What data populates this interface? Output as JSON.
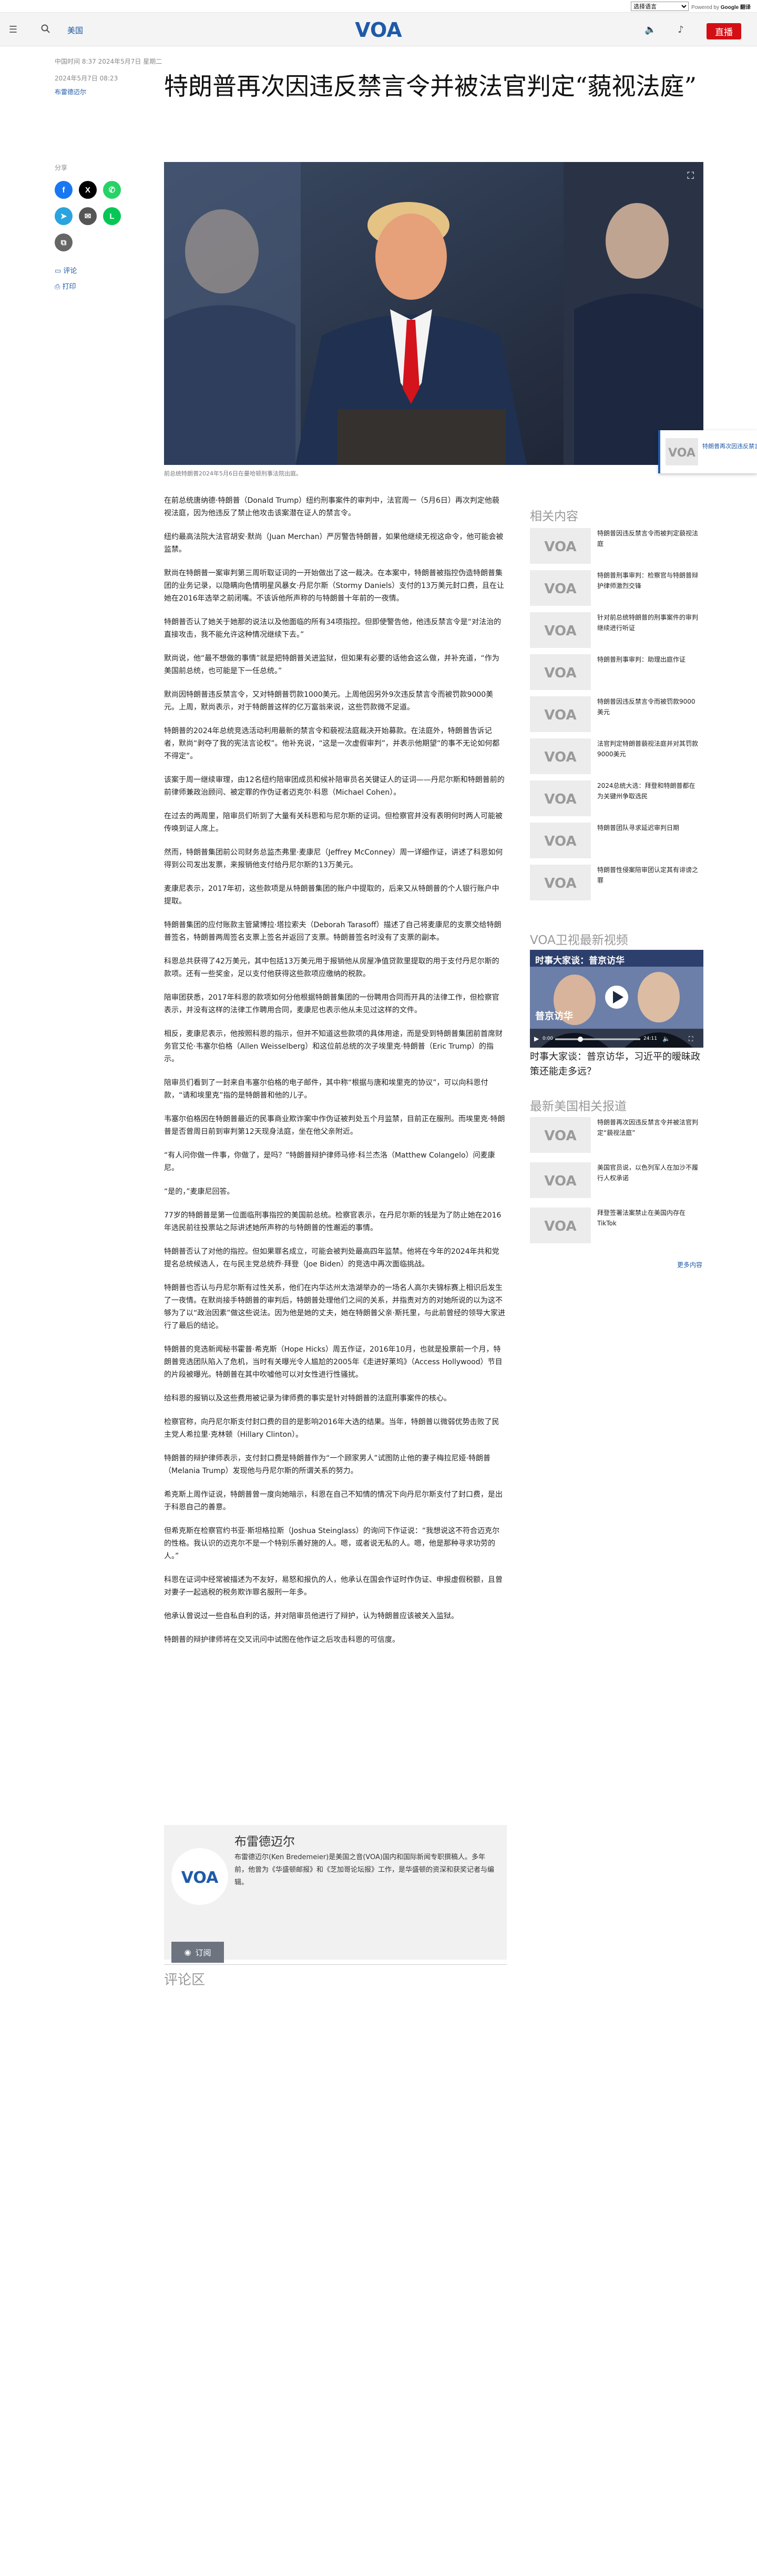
{
  "utility": {
    "language_select": "选择语言",
    "powered_by": "Powered by",
    "google": "Google",
    "translate": "翻译"
  },
  "header": {
    "section_link": "美国",
    "live_label": "直播",
    "brand": "VOA"
  },
  "article": {
    "meta_top": "中国时间 8:37 2024年5月7日 星期二",
    "date_line": "2024年5月7日 08:23",
    "author_top": "布雷德迈尔",
    "title": "特朗普再次因违反禁言令并被法官判定“藐视法庭”",
    "share_label": "分享",
    "comments_link": "评论",
    "print_link": "打印",
    "image_caption": "前总统特朗普2024年5月6日在曼哈顿刑事法院出庭。",
    "paragraphs": [
      "在前总统唐纳德·特朗普（Donald Trump）纽约刑事案件的审判中，法官周一（5月6日）再次判定他藐视法庭，因为他违反了禁止他攻击该案潜在证人的禁言令。",
      "纽约最高法院大法官胡安·默尚（Juan Merchan）严厉警告特朗普，如果他继续无视这命令，他可能会被监禁。",
      "默尚在特朗普一案审判第三周听取证词的一开始做出了这一裁决。在本案中，特朗普被指控伪造特朗普集团的业务记录，以隐瞒向色情明星风暴女·丹尼尔斯（Stormy Daniels）支付的13万美元封口费，且在让她在2016年选举之前闭嘴。不该诉他所声称的与特朗普十年前的一夜情。",
      "特朗普否认了她关于她那的说法以及他面临的所有34项指控。但即使警告他，他违反禁言令是“对法治的直接攻击，我不能允许这种情况继续下去。”",
      "默尚说，他“最不想做的事情”就是把特朗普关进监狱，但如果有必要的话他会这么做，并补充道，“作为美国前总统，也可能是下一任总统。”",
      "默尚因特朗普违反禁言令，又对特朗普罚款1000美元。上周他因另外9次违反禁言令而被罚款9000美元。上周，默尚表示，对于特朗普这样的亿万富翁来说，这些罚款微不足道。",
      "特朗普的2024年总统竞选活动利用最新的禁言令和藐视法庭裁决开始募款。在法庭外，特朗普告诉记者，默尚“剥夺了我的宪法言论权”。他补充说，“这是一次虚假审判”，并表示他期望“的事不无论如何都不得定”。",
      "该案于周一继续审理，由12名纽约陪审团成员和候补陪审员名关键证人的证词——丹尼尔斯和特朗普前的前律师兼政治顾问、被定罪的作伪证者迈克尔·科恩（Michael Cohen）。",
      "在过去的两周里，陪审员们听到了大量有关科恩和与尼尔斯的证词。但检察官并没有表明何时两人可能被传唤到证人席上。",
      "然而，特朗普集团前公司财务总监杰弗里·麦康尼（Jeffrey McConney）周一详细作证，讲述了科恩如何得到公司发出发票，来报销他支付给丹尼尔斯的13万美元。",
      "麦康尼表示，2017年初，这些款项是从特朗普集团的账户中提取的，后来又从特朗普的个人银行账户中提取。",
      "特朗普集团的应付账款主管黛博拉·塔拉索夫（Deborah Tarasoff）描述了自己将麦康尼的支票交给特朗普签名，特朗普两周签名支票上签名并返回了支票。特朗普签名时没有了支票的副本。",
      "科恩总共获得了42万美元，其中包括13万美元用于报销他从房屋净值贷款里提取的用于支付丹尼尔斯的款项。还有一些奖金，足以支付他获得这些款项应缴纳的税款。",
      "陪审团获悉，2017年科恩的款项如何分他根据特朗普集团的一份聘用合同而开具的法律工作，但检察官表示，并没有这样的法律工作聘用合同，麦康尼也表示他从未见过这样的文件。",
      "相反，麦康尼表示，他按照科恩的指示，但并不知道这些款项的具体用途，而是受到特朗普集团前首席财务官艾伦·韦塞尔伯格（Allen Weisselberg）和这位前总统的次子埃里克·特朗普（Eric Trump）的指示。",
      "陪审员们看到了一封来自韦塞尔伯格的电子邮件，其中称“根据与唐和埃里克的协议”，可以向科恩付款，“请和埃里克”指的是特朗普和他的儿子。",
      "韦塞尔伯格因在特朗普最近的民事商业欺诈案中作伪证被判处五个月监禁，目前正在服刑。而埃里克·特朗普是否曾周日前到审判第12天现身法庭，坐在他父亲附近。",
      "“有人问你做一件事，你做了，是吗？”特朗普辩护律师马修·科兰杰洛（Matthew Colangelo）问麦康尼。",
      "“是的，”麦康尼回答。",
      "77岁的特朗普是第一位面临刑事指控的美国前总统。检察官表示，在丹尼尔斯的钱是为了防止她在2016年选民前往投票站之际讲述她所声称的与特朗普的性邂逅的事情。",
      "特朗普否认了对他的指控。但如果罪名成立，可能会被判处最高四年监禁。他将在今年的2024年共和党提名总统候选人，在与民主党总统乔·拜登（Joe Biden）的竞选中再次面临挑战。",
      "特朗普也否认与丹尼尔斯有过性关系，他们在内华达州太浩湖举办的一场名人高尔夫锦标赛上相识后发生了一夜情。在默尚接手特朗普的审判后，特朗普处理他们之间的关系，并指责对方的对她所说的以为这不够为了以“政治因素”做这些说法。因为他是她的丈夫，她在特朗普父亲·斯托里，与此前曾经的领导大家进行了最后的结论。",
      "特朗普的竞选新闻秘书霍普·希克斯（Hope Hicks）周五作证，2016年10月，也就是投票前一个月，特朗普竞选团队陷入了危机，当时有关曝光令人尴尬的2005年《走进好莱坞》（Access Hollywood）节目的片段被曝光。特朗普在其中吹嘘他可以对女性进行性骚扰。",
      "给科恩的报销以及这些费用被记录为律师费的事实是针对特朗普的法庭刑事案件的核心。",
      "检察官称，向丹尼尔斯支付封口费的目的是影响2016年大选的结果。当年，特朗普以微弱优势击败了民主党人希拉里·克林顿（Hillary Clinton）。",
      "特朗普的辩护律师表示，支付封口费是特朗普作为“一个顾家男人”试图防止他的妻子梅拉尼娅·特朗普（Melania Trump）发现他与丹尼尔斯的所谓关系的努力。",
      "希克斯上周作证说，特朗普曾一度向她暗示，科恩在自己不知情的情况下向丹尼尔斯支付了封口费，是出于科恩自己的善意。",
      "但希克斯在检察官约书亚·斯坦格拉斯（Joshua Steinglass）的询问下作证说：“我想说这不符合迈克尔的性格。我认识的迈克尔不是一个特别乐善好施的人。嗯，或者说无私的人。嗯，他是那种寻求功劳的人。”",
      "科恩在证词中经常被描述为不友好，易怒和报仇的人，他承认在国会作证时作伪证、申报虚假税额，且曾对妻子一起逃税的税务欺诈罪名服刑一年多。",
      "他承认曾说过一些自私自利的话，并对陪审员他进行了辩护，认为特朗普应该被关入监狱。",
      "特朗普的辩护律师将在交叉讯问中试图在他作证之后攻击科恩的可信度。"
    ],
    "author_box": {
      "name": "布雷德迈尔",
      "bio": "布雷德迈尔(Ken Bredemeier)是美国之音(VOA)国内和国际新闻专职撰稿人。多年前，他曾为《华盛顿邮报》和《芝加哥论坛报》工作，是华盛顿的资深和获奖记者与编辑。",
      "subscribe": "订阅"
    },
    "comments_heading": "评论区"
  },
  "sidebar": {
    "related_heading": "相关内容",
    "related": [
      "特朗普因违反禁言令而被判定藐视法庭",
      "特朗普刑事审判：检察官与特朗普辩护律师激烈交锋",
      "针对前总统特朗普的刑事案件的审判继续进行听证",
      "特朗普刑事审判：助理出庭作证",
      "特朗普因违反禁言令而被罚款9000美元",
      "法官判定特朗普藐视法庭并对其罚款9000美元",
      "2024总统大选：拜登和特朗普都在为关键州争取选民",
      "特朗普团队寻求延迟审判日期",
      "特朗普性侵案陪审团认定其有诽谤之罪"
    ],
    "video_heading": "VOA卫视最新视频",
    "video_title": "时事大家谈：普京访华，习近平的暧昧政策还能走多远？",
    "video_overlay_title": "时事大家谈：普京访华",
    "video_time": "0:00",
    "video_duration": "24:11",
    "video_badge": "普京访华",
    "news_heading": "最新美国相关报道",
    "news": [
      "特朗普再次因违反禁言令并被法官判定“藐视法庭”",
      "美国官员说，以色列军人在加沙不履行人权承诺",
      "拜登签署法案禁止在美国内存在TikTok"
    ],
    "more_link": "更多内容"
  },
  "floating_player": {
    "text": "特朗普再次因违反禁言令..."
  },
  "colors": {
    "brand_blue": "#1e5aa8",
    "live_red": "#d40f14"
  },
  "icons": [
    "menu-icon",
    "search-icon",
    "speaker-icon",
    "audio-icon",
    "expand-icon",
    "facebook-icon",
    "x-icon",
    "whatsapp-icon",
    "telegram-icon",
    "email-icon",
    "line-icon",
    "copy-link-icon",
    "comment-icon",
    "print-icon",
    "rss-icon",
    "play-icon"
  ]
}
